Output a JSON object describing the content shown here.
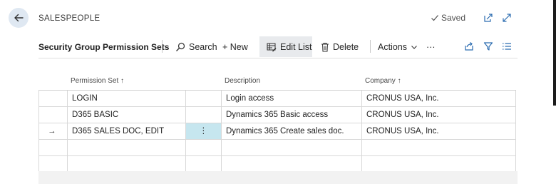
{
  "header": {
    "page_caption": "SALESPEOPLE",
    "saved_label": "Saved",
    "icons": [
      "back-arrow-icon",
      "checkmark-icon",
      "open-in-new-window-icon",
      "expand-icon"
    ]
  },
  "toolbar": {
    "title": "Security Group Permission Sets",
    "search_label": "Search",
    "new_label": "+ New",
    "edit_list_label": "Edit List",
    "delete_label": "Delete",
    "actions_label": "Actions",
    "more_label": "···"
  },
  "columns": {
    "permission_set": "Permission Set ↑",
    "description": "Description",
    "company": "Company ↑"
  },
  "rows": [
    {
      "marker": "",
      "permission_set": "LOGIN",
      "menu": "",
      "description": "Login access",
      "company": "CRONUS USA, Inc."
    },
    {
      "marker": "",
      "permission_set": "D365 BASIC",
      "menu": "",
      "description": "Dynamics 365 Basic access",
      "company": "CRONUS USA, Inc."
    },
    {
      "marker": "→",
      "permission_set": "D365 SALES DOC, EDIT",
      "menu": "⋮",
      "description": "Dynamics 365 Create sales doc.",
      "company": "CRONUS USA, Inc."
    },
    {
      "marker": "",
      "permission_set": "",
      "menu": "",
      "description": "",
      "company": ""
    },
    {
      "marker": "",
      "permission_set": "",
      "menu": "",
      "description": "",
      "company": ""
    }
  ],
  "colors": {
    "accent": "#2b6cb0",
    "selected_cell": "#c6e6ef",
    "back_button_bg": "#dfe8f2"
  }
}
